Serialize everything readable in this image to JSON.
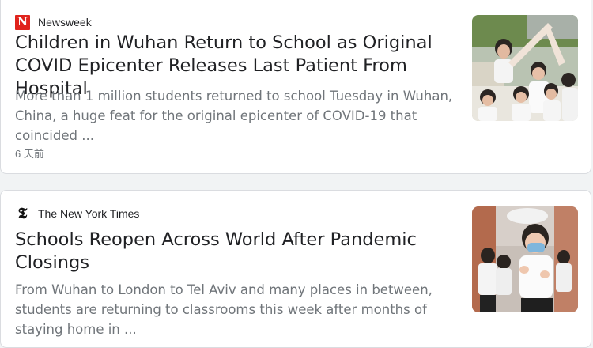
{
  "results": [
    {
      "source": "Newsweek",
      "source_logo": "newsweek-logo-icon",
      "logo_letter": "N",
      "headline": "Children in Wuhan Return to School as Original COVID Epicenter Releases Last Patient From Hospital",
      "snippet": "More than 1 million students returned to school Tuesday in Wuhan, China, a huge feat for the original epicenter of COVID-19 that coincided ...",
      "time": "6 天前",
      "thumbnail": "students-raising-hands-photo"
    },
    {
      "source": "The New York Times",
      "source_logo": "nyt-logo-icon",
      "logo_letter": "𝕿",
      "headline": "Schools Reopen Across World After Pandemic Closings",
      "snippet": "From Wuhan to London to Tel Aviv and many places in between, students are returning to classrooms this week after months of staying home in ...",
      "thumbnail": "student-with-mask-photo"
    }
  ],
  "colors": {
    "newsweek_red": "#e0231c",
    "snippet_gray": "#70757a",
    "headline_text": "#202124"
  }
}
